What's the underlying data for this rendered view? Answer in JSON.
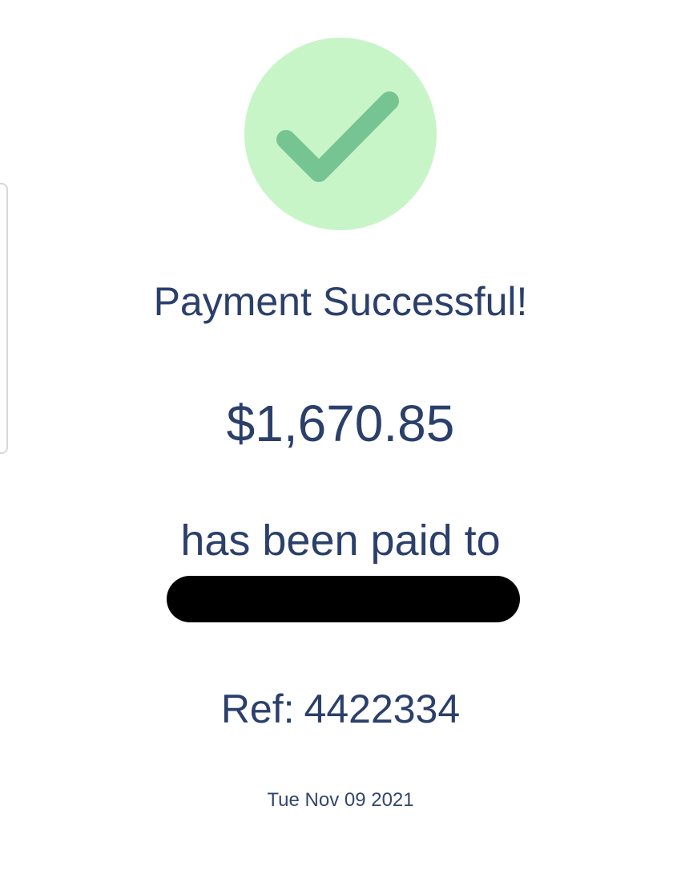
{
  "status": {
    "icon": "check-icon",
    "title": "Payment Successful!"
  },
  "payment": {
    "amount": "$1,670.85",
    "paid_to_text": "has been paid to",
    "reference_label": "Ref:",
    "reference_number": "4422334",
    "date": "Tue Nov 09 2021"
  },
  "colors": {
    "text": "#2b3f6b",
    "success_circle": "#c8f5c8",
    "check_mark": "#77c493",
    "redaction": "#000000"
  }
}
